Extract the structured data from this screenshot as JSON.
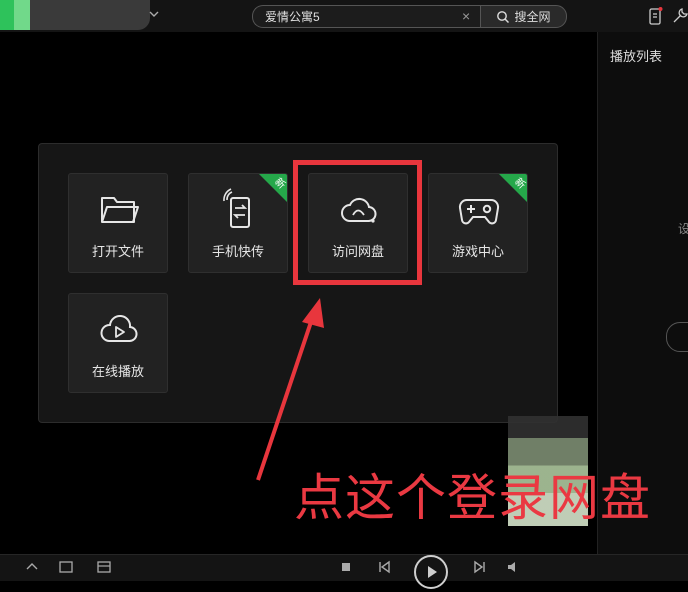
{
  "topbar": {
    "search": {
      "value": "爱情公寓5",
      "clear_label": "×",
      "button_label": "搜全网"
    }
  },
  "playlist": {
    "title": "播放列表",
    "partial_text": "设"
  },
  "menu": {
    "tiles": [
      {
        "label": "打开文件",
        "icon": "folder-icon",
        "badge": ""
      },
      {
        "label": "手机快传",
        "icon": "phone-transfer-icon",
        "badge": "新"
      },
      {
        "label": "访问网盘",
        "icon": "cloud-drive-icon",
        "badge": ""
      },
      {
        "label": "游戏中心",
        "icon": "gamepad-icon",
        "badge": "新"
      },
      {
        "label": "在线播放",
        "icon": "cloud-play-icon",
        "badge": ""
      }
    ]
  },
  "annotation": {
    "text": "点这个登录网盘",
    "color": "#ea3942"
  },
  "colors": {
    "accent_green": "#25a84a",
    "highlight_red": "#e8363d"
  }
}
